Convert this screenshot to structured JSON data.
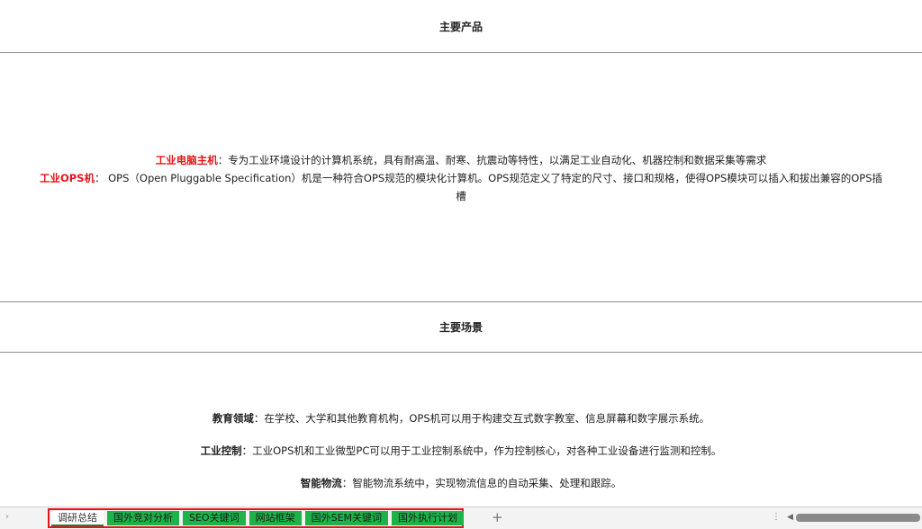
{
  "sections": {
    "products_header": "主要产品",
    "products": [
      {
        "term": "工业电脑主机",
        "sep": "：",
        "desc": "专为工业环境设计的计算机系统，具有耐高温、耐寒、抗震动等特性，以满足工业自动化、机器控制和数据采集等需求"
      },
      {
        "term": "工业OPS机",
        "sep": "：",
        "desc": "  OPS（Open Pluggable Specification）机是一种符合OPS规范的模块化计算机。OPS规范定义了特定的尺寸、接口和规格，使得OPS模块可以插入和拔出兼容的OPS插",
        "desc_wrap": "槽"
      }
    ],
    "scenes_header": "主要场景",
    "scenes": [
      {
        "term": "教育领域",
        "sep": "：",
        "desc": "在学校、大学和其他教育机构，OPS机可以用于构建交互式数字教室、信息屏幕和数字展示系统。"
      },
      {
        "term": "工业控制",
        "sep": "：",
        "desc": "工业OPS机和工业微型PC可以用于工业控制系统中，作为控制核心，对各种工业设备进行监测和控制。"
      },
      {
        "term": "智能物流",
        "sep": "：",
        "desc": "智能物流系统中，实现物流信息的自动采集、处理和跟踪。"
      }
    ]
  },
  "tabs": [
    {
      "label": "调研总结",
      "active": true
    },
    {
      "label": "国外竞对分析",
      "active": false
    },
    {
      "label": "SEO关键词",
      "active": false
    },
    {
      "label": "网站框架",
      "active": false
    },
    {
      "label": "国外SEM关键词",
      "active": false
    },
    {
      "label": "国外执行计划",
      "active": false
    }
  ],
  "colors": {
    "highlight": "#e5141a",
    "tab_green": "#1db34a",
    "tab_box": "#e5141a"
  },
  "icons": {
    "prev": "chevron-right-icon",
    "add": "plus-icon",
    "more": "more-vertical-icon",
    "scroll": "triangle-left-icon"
  }
}
